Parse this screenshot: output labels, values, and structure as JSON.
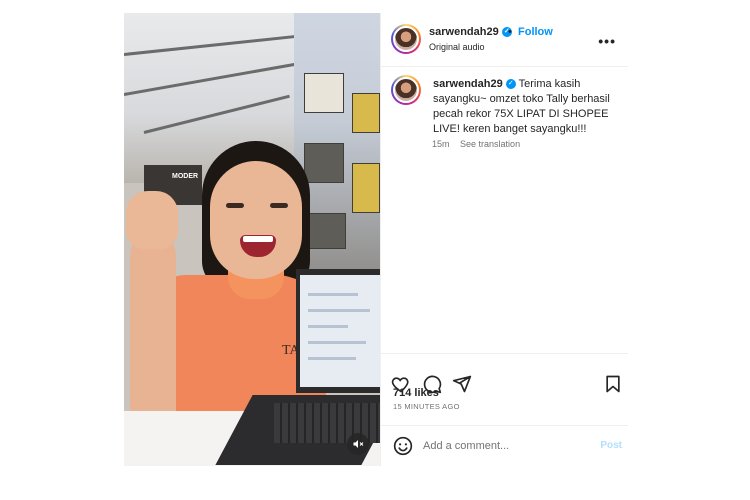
{
  "header": {
    "username": "sarwendah29",
    "verified": true,
    "follow_label": "Follow",
    "separator": "•",
    "audio": "Original audio",
    "more_label": "•••"
  },
  "caption": {
    "username": "sarwendah29",
    "text": "Terima kasih sayangku~ omzet toko Tally berhasil pecah rekor 75X LIPAT DI SHOPEE LIVE! keren banget sayangku!!!",
    "time": "15m",
    "see_translation": "See translation"
  },
  "media": {
    "sign_text": "MODER",
    "shirt_logo": "TA"
  },
  "engagement": {
    "likes": "714 likes",
    "time_ago": "15 MINUTES AGO"
  },
  "comment": {
    "placeholder": "Add a comment...",
    "post_label": "Post"
  },
  "icons": [
    "heart-icon",
    "comment-icon",
    "share-icon",
    "bookmark-icon",
    "emoji-icon",
    "mute-icon",
    "verified-icon",
    "more-icon"
  ],
  "colors": {
    "link": "#0095f6",
    "post_disabled": "#b2dffc",
    "secondary_text": "#737373"
  }
}
